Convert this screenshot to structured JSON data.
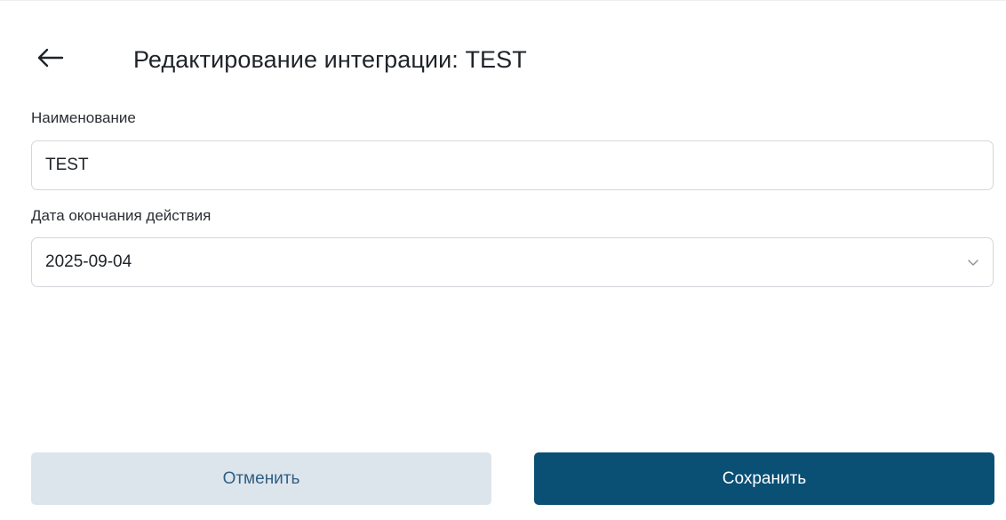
{
  "header": {
    "title": "Редактирование интеграции: TEST",
    "back_icon": "arrow-left-icon"
  },
  "form": {
    "name_label": "Наименование",
    "name_value": "TEST",
    "date_label": "Дата окончания действия",
    "date_value": "2025-09-04",
    "date_icon": "chevron-down-icon"
  },
  "actions": {
    "cancel_label": "Отменить",
    "save_label": "Сохранить"
  },
  "colors": {
    "primary": "#0a4f74",
    "secondary_bg": "#dde5ec",
    "secondary_text": "#2f5f84",
    "border": "#d3d7db"
  }
}
